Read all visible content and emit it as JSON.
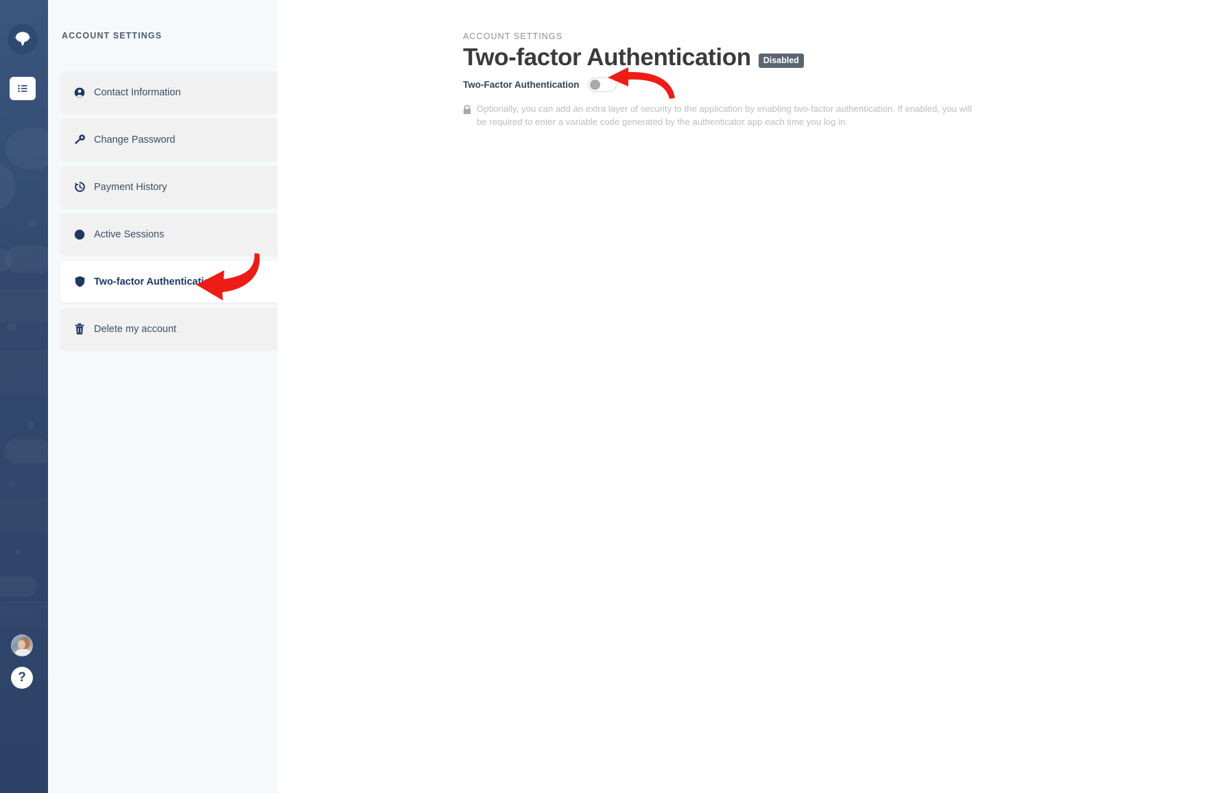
{
  "rail": {
    "logo_icon": "planet-logo-icon",
    "nav_items": [
      {
        "icon": "list-icon",
        "name": "rail-nav-list"
      }
    ],
    "avatar_name": "user-avatar",
    "help_label": "?"
  },
  "sidebar": {
    "title": "ACCOUNT SETTINGS",
    "items": [
      {
        "label": "Contact Information",
        "icon": "user-circle-icon",
        "active": false
      },
      {
        "label": "Change Password",
        "icon": "key-icon",
        "active": false
      },
      {
        "label": "Payment History",
        "icon": "history-icon",
        "active": false
      },
      {
        "label": "Active Sessions",
        "icon": "globe-icon",
        "active": false
      },
      {
        "label": "Two-factor Authentication",
        "icon": "shield-icon",
        "active": true
      },
      {
        "label": "Delete my account",
        "icon": "trash-icon",
        "active": false
      }
    ]
  },
  "main": {
    "breadcrumb": "ACCOUNT SETTINGS",
    "title": "Two-factor Authentication",
    "status_badge": "Disabled",
    "toggle": {
      "label": "Two-Factor Authentication",
      "state": "off"
    },
    "description": "Optionally, you can add an extra layer of security to the application by enabling two-factor authentication. If enabled, you will be required to enter a variable code generated by the authenticator app each time you log in.",
    "description_icon": "lock-icon"
  },
  "annotations": {
    "color": "#ee1c16",
    "arrows": [
      {
        "name": "arrow-pointing-to-toggle",
        "target": "two-factor-toggle"
      },
      {
        "name": "arrow-pointing-to-menu-item",
        "target": "sidebar-item-two-factor-authentication"
      }
    ]
  },
  "colors": {
    "rail_bg": "#334e75",
    "menu_bg": "#f5f9fc",
    "card_bg": "#f1f1f1",
    "card_active_bg": "#ffffff",
    "accent_text": "#1f3864",
    "badge_bg": "#5a6570",
    "annotation_red": "#ee1c16"
  }
}
